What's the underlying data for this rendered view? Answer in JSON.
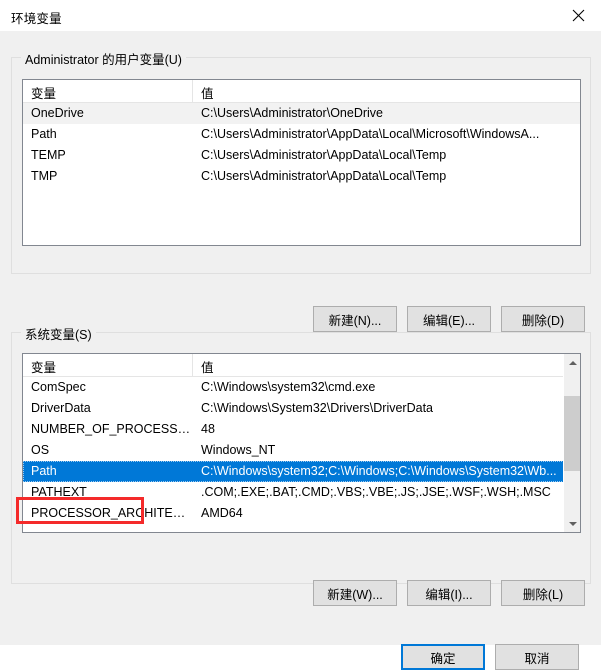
{
  "window": {
    "title": "环境变量",
    "close_label": "✕",
    "close_icon": "close-icon"
  },
  "user_section": {
    "legend": "Administrator 的用户变量(U)",
    "columns": [
      "变量",
      "值"
    ],
    "rows": [
      {
        "name": "OneDrive",
        "value": "C:\\Users\\Administrator\\OneDrive",
        "state": "hover"
      },
      {
        "name": "Path",
        "value": "C:\\Users\\Administrator\\AppData\\Local\\Microsoft\\WindowsA...",
        "state": "normal"
      },
      {
        "name": "TEMP",
        "value": "C:\\Users\\Administrator\\AppData\\Local\\Temp",
        "state": "normal"
      },
      {
        "name": "TMP",
        "value": "C:\\Users\\Administrator\\AppData\\Local\\Temp",
        "state": "normal"
      }
    ],
    "buttons": {
      "new": "新建(N)...",
      "edit": "编辑(E)...",
      "delete": "删除(D)"
    }
  },
  "system_section": {
    "legend": "系统变量(S)",
    "columns": [
      "变量",
      "值"
    ],
    "rows": [
      {
        "name": "ComSpec",
        "value": "C:\\Windows\\system32\\cmd.exe",
        "state": "normal"
      },
      {
        "name": "DriverData",
        "value": "C:\\Windows\\System32\\Drivers\\DriverData",
        "state": "normal"
      },
      {
        "name": "NUMBER_OF_PROCESSORS",
        "value": "48",
        "state": "normal"
      },
      {
        "name": "OS",
        "value": "Windows_NT",
        "state": "normal"
      },
      {
        "name": "Path",
        "value": "C:\\Windows\\system32;C:\\Windows;C:\\Windows\\System32\\Wb...",
        "state": "selected"
      },
      {
        "name": "PATHEXT",
        "value": ".COM;.EXE;.BAT;.CMD;.VBS;.VBE;.JS;.JSE;.WSF;.WSH;.MSC",
        "state": "normal"
      },
      {
        "name": "PROCESSOR_ARCHITECT...",
        "value": "AMD64",
        "state": "normal"
      }
    ],
    "scrollbar": {
      "up_icon": "chevron-up-icon",
      "down_icon": "chevron-down-icon",
      "thumb_top_pct": 14,
      "thumb_height_pct": 42
    },
    "buttons": {
      "new": "新建(W)...",
      "edit": "编辑(I)...",
      "delete": "删除(L)"
    }
  },
  "dialog_buttons": {
    "ok": "确定",
    "cancel": "取消"
  },
  "annotation": {
    "label": "highlight-rectangle-system-path",
    "color": "#f42a2a"
  },
  "colors": {
    "selection": "#0078d7",
    "dialog_bg": "#f0f0f0",
    "list_bg": "#ffffff",
    "button_bg": "#e1e1e1",
    "annotation": "#f42a2a"
  }
}
